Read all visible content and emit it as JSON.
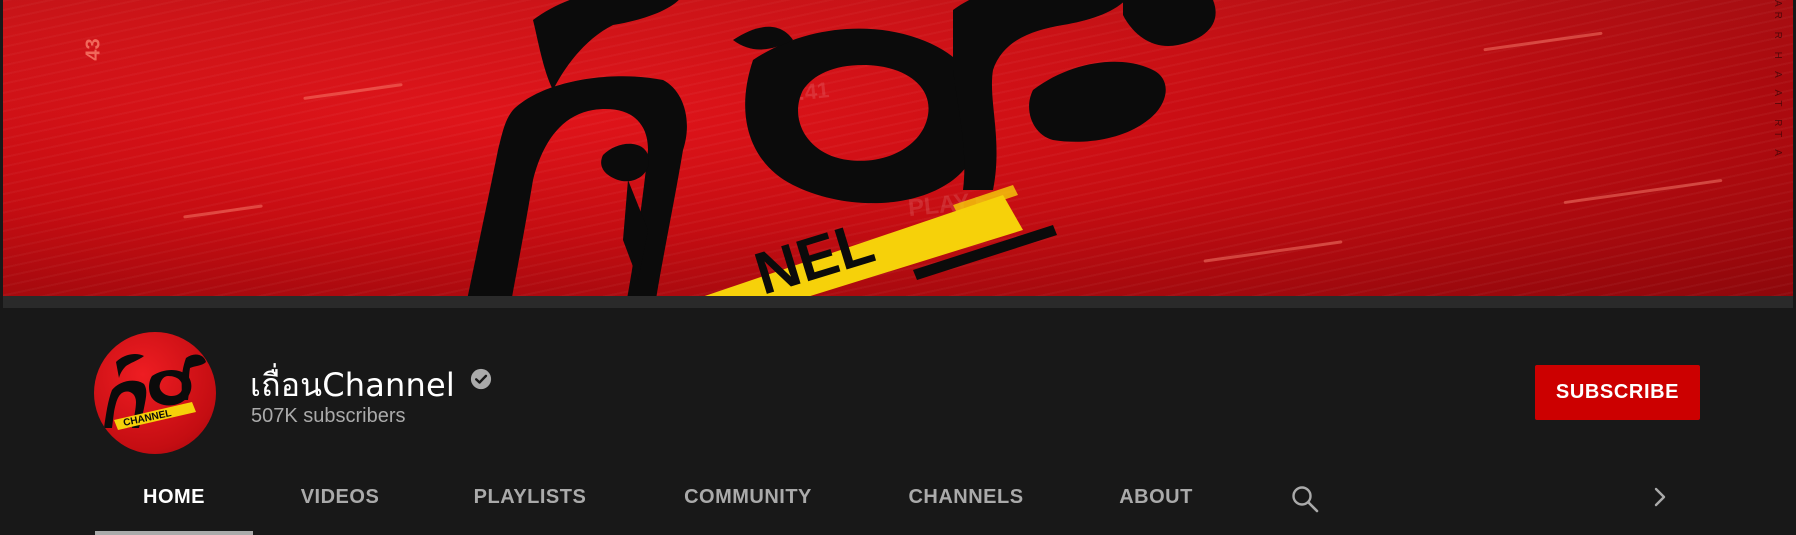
{
  "channel": {
    "name": "เถื่อนChannel",
    "verified": true,
    "subscribers": "507K subscribers",
    "avatar_label": "CHANNEL"
  },
  "subscribe_label": "SUBSCRIBE",
  "tabs": [
    {
      "label": "HOME",
      "active": true
    },
    {
      "label": "VIDEOS",
      "active": false
    },
    {
      "label": "PLAYLISTS",
      "active": false
    },
    {
      "label": "COMMUNITY",
      "active": false
    },
    {
      "label": "CHANNELS",
      "active": false
    },
    {
      "label": "ABOUT",
      "active": false
    }
  ],
  "banner": {
    "edge_number": "43",
    "play_text": "PLAY ▸",
    "time_text": "00:41",
    "logo_text_fragment": "NEL",
    "side_text": "AR R H A AT RT A"
  },
  "icons": {
    "search": "search-icon",
    "next": "chevron-right-icon",
    "verified": "verified-check-icon"
  },
  "colors": {
    "background": "#181818",
    "subscribe": "#cc0000",
    "banner_red": "#d0101a",
    "tab_active": "#ffffff",
    "tab_inactive": "#aaaaaa",
    "subscriber_text": "#aaaaaa"
  }
}
